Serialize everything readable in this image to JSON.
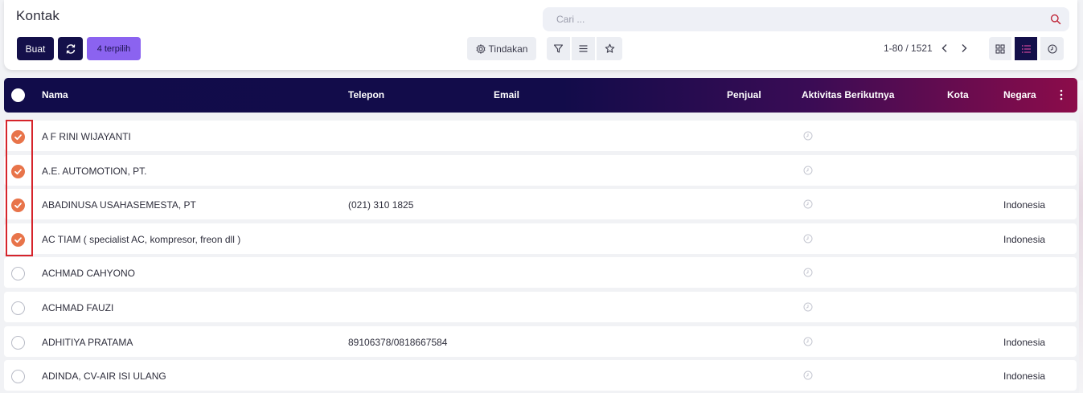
{
  "header": {
    "title": "Kontak",
    "search_placeholder": "Cari ..."
  },
  "toolbar": {
    "create_label": "Buat",
    "selected_label": "4 terpilih",
    "action_label": "Tindakan",
    "pager_text": "1-80 / 1521"
  },
  "table": {
    "columns": {
      "name": "Nama",
      "phone": "Telepon",
      "email": "Email",
      "salesperson": "Penjual",
      "next_activity": "Aktivitas Berikutnya",
      "city": "Kota",
      "country": "Negara"
    },
    "rows": [
      {
        "selected": true,
        "name": "A F RINI WIJAYANTI",
        "phone": "",
        "email": "",
        "salesperson": "",
        "city": "",
        "country": ""
      },
      {
        "selected": true,
        "name": "A.E. AUTOMOTION, PT.",
        "phone": "",
        "email": "",
        "salesperson": "",
        "city": "",
        "country": ""
      },
      {
        "selected": true,
        "name": "ABADINUSA USAHASEMESTA, PT",
        "phone": "(021) 310 1825",
        "email": "",
        "salesperson": "",
        "city": "",
        "country": "Indonesia"
      },
      {
        "selected": true,
        "name": "AC TIAM ( specialist AC, kompresor, freon dll )",
        "phone": "",
        "email": "",
        "salesperson": "",
        "city": "",
        "country": "Indonesia"
      },
      {
        "selected": false,
        "name": "ACHMAD CAHYONO",
        "phone": "",
        "email": "",
        "salesperson": "",
        "city": "",
        "country": ""
      },
      {
        "selected": false,
        "name": "ACHMAD FAUZI",
        "phone": "",
        "email": "",
        "salesperson": "",
        "city": "",
        "country": ""
      },
      {
        "selected": false,
        "name": "ADHITIYA PRATAMA",
        "phone": "89106378/0818667584",
        "email": "",
        "salesperson": "",
        "city": "",
        "country": "Indonesia"
      },
      {
        "selected": false,
        "name": "ADINDA, CV-AIR ISI ULANG",
        "phone": "",
        "email": "",
        "salesperson": "",
        "city": "",
        "country": "Indonesia"
      }
    ]
  },
  "colors": {
    "primary": "#14104a",
    "accent": "#8b63f0",
    "checked": "#e8744a",
    "highlight": "#d6242b"
  },
  "icons": [
    "refresh-icon",
    "gear-icon",
    "filter-icon",
    "group-by-icon",
    "favorite-star-icon",
    "search-icon",
    "chevron-left-icon",
    "chevron-right-icon",
    "kanban-view-icon",
    "list-view-icon",
    "activity-view-icon",
    "clock-icon",
    "kebab-menu-icon",
    "check-icon"
  ]
}
